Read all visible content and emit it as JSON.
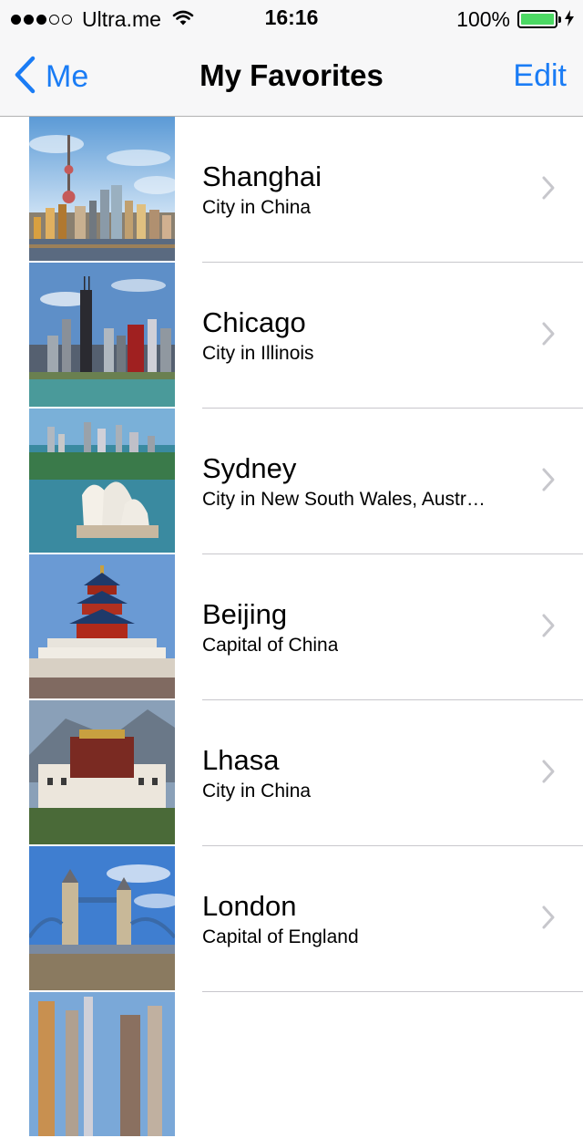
{
  "status": {
    "carrier": "Ultra.me",
    "signal_bars_filled": 3,
    "signal_bars_total": 5,
    "time": "16:16",
    "battery_percent": "100%",
    "battery_level": 1.0,
    "icons": [
      "signal-dots-icon",
      "wifi-icon",
      "battery-icon",
      "charging-bolt-icon"
    ]
  },
  "nav": {
    "back_label": "Me",
    "title": "My Favorites",
    "edit_label": "Edit",
    "accent_color": "#1a7cf5"
  },
  "favorites": [
    {
      "title": "Shanghai",
      "subtitle": "City in China"
    },
    {
      "title": "Chicago",
      "subtitle": "City in Illinois"
    },
    {
      "title": "Sydney",
      "subtitle": "City in New South Wales, Austr…"
    },
    {
      "title": "Beijing",
      "subtitle": "Capital of China"
    },
    {
      "title": "Lhasa",
      "subtitle": "City in China"
    },
    {
      "title": "London",
      "subtitle": "Capital of England"
    },
    {
      "title": "",
      "subtitle": ""
    }
  ]
}
